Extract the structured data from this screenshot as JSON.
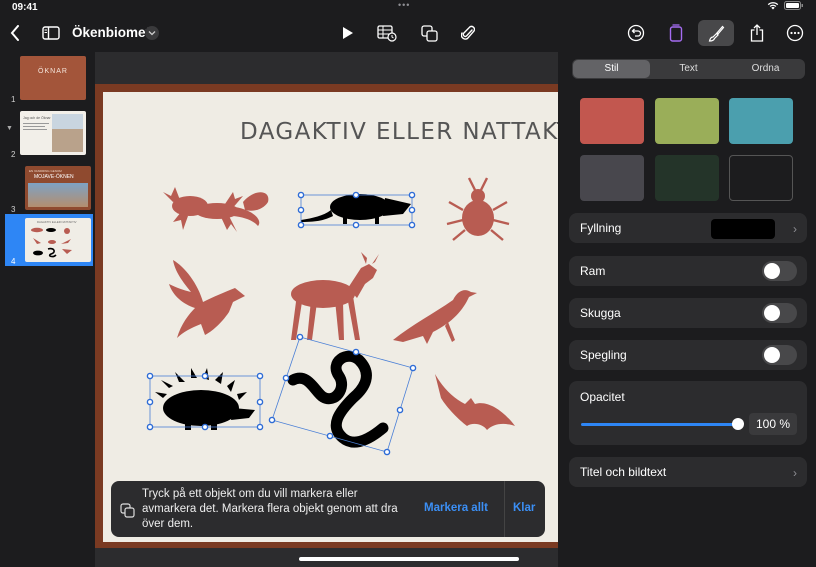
{
  "status": {
    "time": "09:41"
  },
  "toolbar": {
    "doc_title": "Ökenbiomet"
  },
  "sidebar": {
    "slides": [
      {
        "number": "1",
        "thumb_title": "ÖKNAR"
      },
      {
        "number": "2",
        "thumb_title": "Jag och de Öknar"
      },
      {
        "number": "3",
        "thumb_title": "MOJAVE-ÖKNEN"
      },
      {
        "number": "4",
        "thumb_title": "DAGAKTIV ELLER NATTAKTIV"
      }
    ]
  },
  "slide": {
    "title": "DAGAKTIV ELLER NATTAKTIV"
  },
  "hint": {
    "text": "Tryck på ett objekt om du vill markera eller avmarkera det. Markera flera objekt genom att dra över dem.",
    "select_all_label": "Markera allt",
    "done_label": "Klar"
  },
  "inspector": {
    "tabs": [
      "Stil",
      "Text",
      "Ordna"
    ],
    "active_tab": "Stil",
    "swatch_colors": [
      "#c2574f",
      "#9aae59",
      "#4b9fae",
      "#48474d",
      "#243429",
      "#2a2a2a"
    ],
    "fill_label": "Fyllning",
    "border_label": "Ram",
    "shadow_label": "Skugga",
    "reflection_label": "Spegling",
    "opacity_label": "Opacitet",
    "opacity_value": "100 %",
    "caption_label": "Titel och bildtext"
  },
  "colors": {
    "accent": "#2e86f5",
    "animal": "#b85c52",
    "selected_animal": "#000000"
  }
}
